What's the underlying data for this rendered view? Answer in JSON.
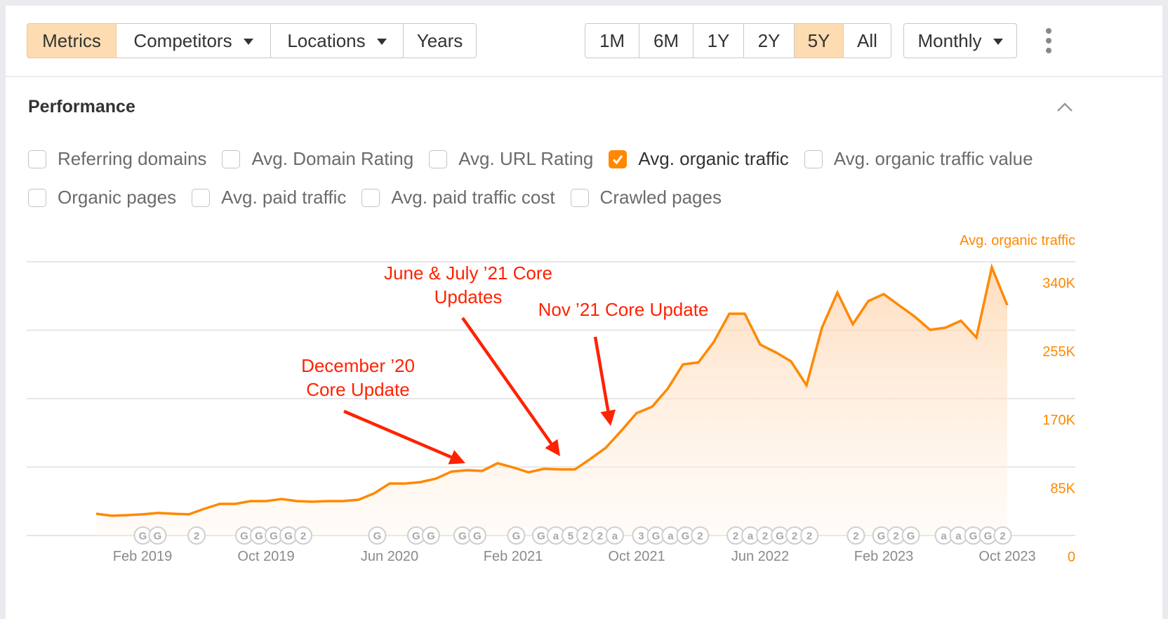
{
  "toolbar": {
    "left_group": [
      {
        "label": "Metrics",
        "active": true,
        "dropdown": false
      },
      {
        "label": "Competitors",
        "active": false,
        "dropdown": true
      },
      {
        "label": "Locations",
        "active": false,
        "dropdown": true
      },
      {
        "label": "Years",
        "active": false,
        "dropdown": false
      }
    ],
    "range_group": [
      {
        "label": "1M",
        "active": false
      },
      {
        "label": "6M",
        "active": false
      },
      {
        "label": "1Y",
        "active": false
      },
      {
        "label": "2Y",
        "active": false
      },
      {
        "label": "5Y",
        "active": true
      },
      {
        "label": "All",
        "active": false
      }
    ],
    "interval": {
      "label": "Monthly",
      "dropdown": true
    },
    "more_icon": "kebab-vertical-icon"
  },
  "section": {
    "title": "Performance",
    "collapse_icon": "chevron-up-icon"
  },
  "metrics_checkboxes": [
    [
      {
        "label": "Referring domains",
        "checked": false
      },
      {
        "label": "Avg. Domain Rating",
        "checked": false
      },
      {
        "label": "Avg. URL Rating",
        "checked": false
      },
      {
        "label": "Avg. organic traffic",
        "checked": true
      },
      {
        "label": "Avg. organic traffic value",
        "checked": false
      }
    ],
    [
      {
        "label": "Organic pages",
        "checked": false
      },
      {
        "label": "Avg. paid traffic",
        "checked": false
      },
      {
        "label": "Avg. paid traffic cost",
        "checked": false
      },
      {
        "label": "Crawled pages",
        "checked": false
      }
    ]
  ],
  "colors": {
    "accent": "#ff8800",
    "active_button": "#fddcb1",
    "annotation": "#ff2200",
    "marker": "#a8a8a8"
  },
  "chart_data": {
    "type": "area",
    "series_name": "Avg. organic traffic",
    "y_axis_title": "Avg. organic traffic",
    "y_ticks": [
      "0",
      "85K",
      "170K",
      "255K",
      "340K"
    ],
    "ylim": [
      0,
      340000
    ],
    "y_tick_values": [
      0,
      85000,
      170000,
      255000,
      340000
    ],
    "x_tick_labels": [
      "Feb 2019",
      "Oct 2019",
      "Jun 2020",
      "Feb 2021",
      "Oct 2021",
      "Jun 2022",
      "Feb 2023",
      "Oct 2023"
    ],
    "x_tick_index": [
      3,
      11,
      19,
      27,
      35,
      43,
      51,
      59
    ],
    "values": [
      27000,
      24500,
      25300,
      26200,
      28000,
      27000,
      26200,
      33100,
      39200,
      39200,
      42700,
      42700,
      45300,
      42700,
      41900,
      42700,
      42700,
      44500,
      52300,
      64500,
      64500,
      66300,
      70600,
      79300,
      81100,
      80200,
      89800,
      84600,
      78500,
      82800,
      82000,
      82000,
      95100,
      109000,
      130000,
      152000,
      160000,
      182000,
      212500,
      215000,
      240500,
      275500,
      275500,
      237200,
      227600,
      216300,
      186600,
      258100,
      301700,
      262400,
      291200,
      299900,
      285900,
      272000,
      255400,
      258100,
      266800,
      245900,
      333100,
      286000
    ],
    "grid": true,
    "legend": "none",
    "annotations": [
      {
        "lines": [
          "December ’20",
          "Core Update"
        ],
        "points_to_index": 23
      },
      {
        "lines": [
          "June & July ’21 Core",
          "Updates"
        ],
        "points_to_index": 30
      },
      {
        "lines": [
          "Nov ’21 Core Update"
        ],
        "points_to_index": 33
      }
    ],
    "event_markers": [
      {
        "index": 3.5,
        "labels": [
          "G",
          "G"
        ]
      },
      {
        "index": 6.5,
        "labels": [
          "2"
        ]
      },
      {
        "index": 11.5,
        "labels": [
          "G",
          "G",
          "G",
          "G",
          "2"
        ]
      },
      {
        "index": 18.2,
        "labels": [
          "G"
        ]
      },
      {
        "index": 21.2,
        "labels": [
          "G",
          "G"
        ]
      },
      {
        "index": 24.2,
        "labels": [
          "G",
          "G"
        ]
      },
      {
        "index": 27.2,
        "labels": [
          "G"
        ]
      },
      {
        "index": 31.2,
        "labels": [
          "G",
          "a",
          "5",
          "2",
          "2",
          "a"
        ]
      },
      {
        "index": 37.2,
        "labels": [
          "3",
          "G",
          "a",
          "G",
          "2"
        ]
      },
      {
        "index": 43.8,
        "labels": [
          "2",
          "a",
          "2",
          "G",
          "2",
          "2"
        ]
      },
      {
        "index": 49.2,
        "labels": [
          "2"
        ]
      },
      {
        "index": 51.8,
        "labels": [
          "G",
          "2",
          "G"
        ]
      },
      {
        "index": 56.8,
        "labels": [
          "a",
          "a",
          "G",
          "G",
          "2"
        ]
      }
    ]
  }
}
